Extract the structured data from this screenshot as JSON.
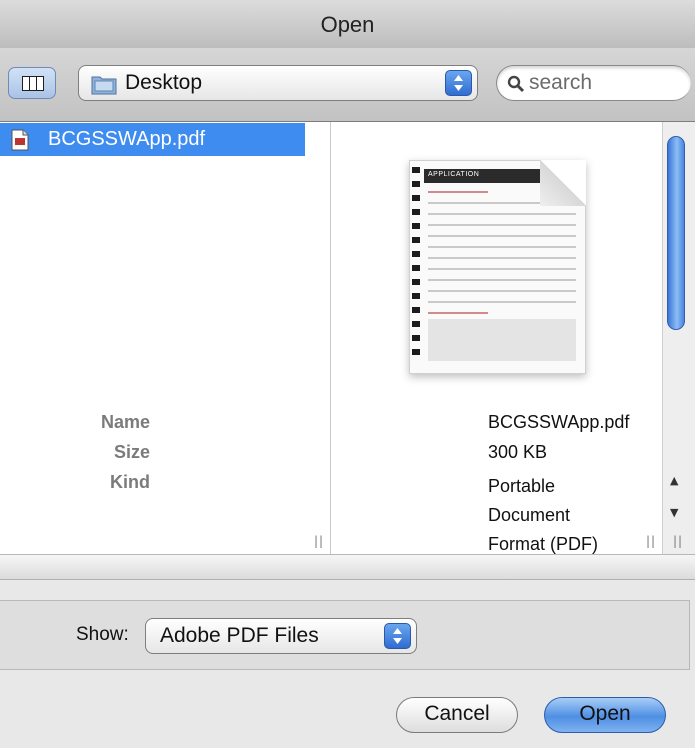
{
  "window": {
    "title": "Open"
  },
  "toolbar": {
    "view_mode_icon": "column-view-icon",
    "location": "Desktop",
    "location_icon": "folder-icon",
    "search_placeholder": "search"
  },
  "browser": {
    "files": [
      {
        "name": "BCGSSWApp.pdf",
        "icon": "pdf-file-icon",
        "selected": true
      }
    ],
    "preview": {
      "thumbnail_title": "APPLICATION",
      "info": [
        {
          "label": "Name",
          "value": "BCGSSWApp.pdf"
        },
        {
          "label": "Size",
          "value": "300 KB"
        },
        {
          "label": "Kind",
          "value": "Portable Document Format (PDF)"
        }
      ]
    }
  },
  "filter": {
    "label": "Show:",
    "selected": "Adobe PDF Files"
  },
  "buttons": {
    "cancel": "Cancel",
    "open": "Open"
  },
  "colors": {
    "selection": "#3e8cf0",
    "default_button": "#4f8fe4"
  }
}
